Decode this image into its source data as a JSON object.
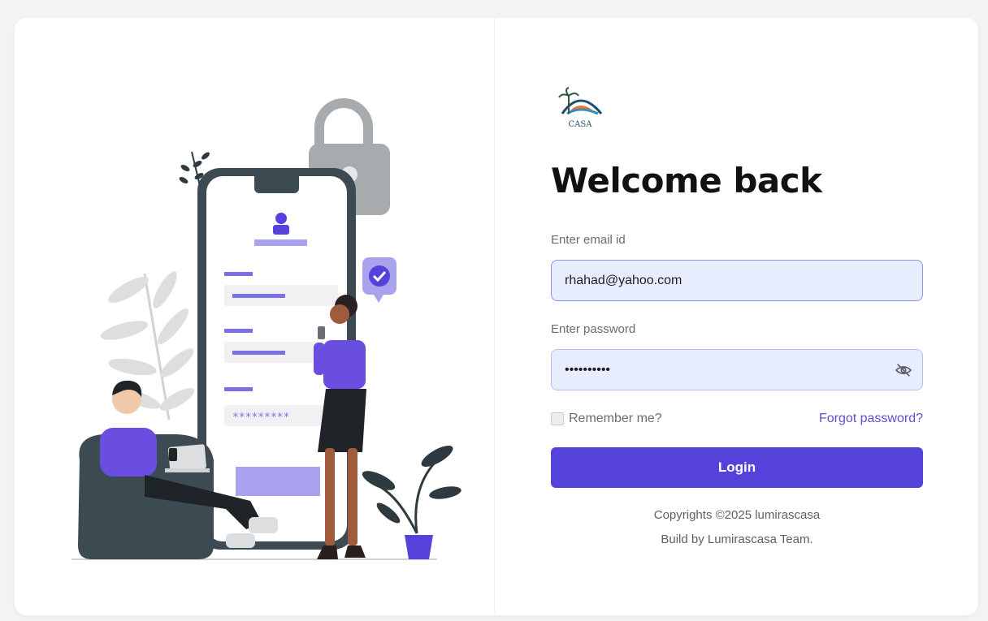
{
  "brand": {
    "logo_icon": "casa-logo-icon",
    "logo_text": "CASA"
  },
  "form": {
    "title": "Welcome back",
    "email_label": "Enter email id",
    "email_value": "rhahad@yahoo.com",
    "password_label": "Enter password",
    "password_value": "••••••••••",
    "password_toggle_icon": "eye-off-icon",
    "remember_label": "Remember me?",
    "remember_checked": false,
    "forgot_label": "Forgot password?",
    "login_label": "Login"
  },
  "footer": {
    "copyright": "Copyrights ©2025 lumirascasa",
    "build": "Build by Lumirascasa Team."
  },
  "colors": {
    "accent": "#5442db",
    "field_bg": "#e8edfd",
    "field_border": "#b7bff0",
    "title": "#111111"
  },
  "illustration": {
    "phone_form_dots": "*********"
  }
}
